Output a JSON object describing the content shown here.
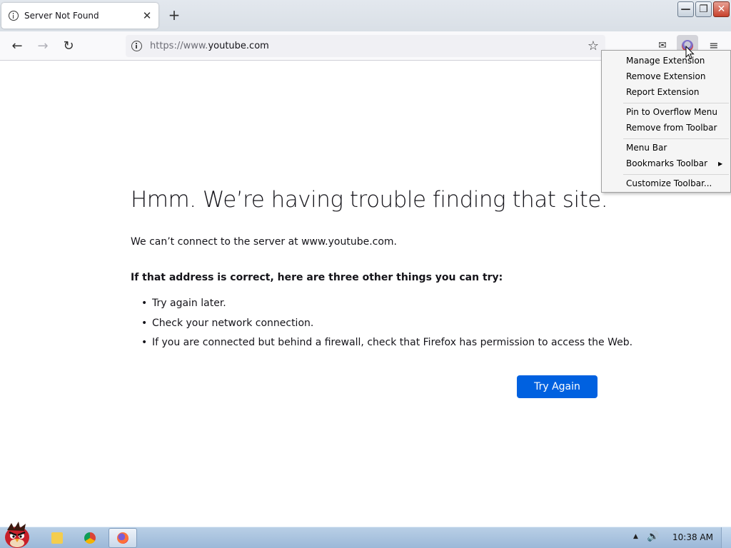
{
  "browser": {
    "tab": {
      "title": "Server Not Found",
      "close_glyph": "✕"
    },
    "new_tab_glyph": "+",
    "window_controls": {
      "minimize": "—",
      "restore": "❐",
      "close": "✕"
    },
    "nav": {
      "back_glyph": "←",
      "forward_glyph": "→",
      "reload_glyph": "↻"
    },
    "url": {
      "prefix": "https://www.",
      "domain": "youtube.com"
    },
    "bookmark_glyph": "☆",
    "pocket_glyph": "✉",
    "menu_glyph": "≡"
  },
  "error_page": {
    "title": "Hmm. We’re having trouble finding that site.",
    "description": "We can’t connect to the server at www.youtube.com.",
    "suggestions_heading": "If that address is correct, here are three other things you can try:",
    "suggestions": [
      "Try again later.",
      "Check your network connection.",
      "If you are connected but behind a firewall, check that Firefox has permission to access the Web."
    ],
    "try_again_label": "Try Again"
  },
  "context_menu": {
    "items": [
      "Manage Extension",
      "Remove Extension",
      "Report Extension",
      "Pin to Overflow Menu",
      "Remove from Toolbar",
      "Menu Bar",
      "Bookmarks Toolbar",
      "Customize Toolbar..."
    ],
    "submenu_arrow": "▶"
  },
  "taskbar": {
    "clock": "10:38 AM",
    "tray_arrow": "▲",
    "volume_glyph": "🔊"
  },
  "colors": {
    "accent_button": "#0061e0",
    "taskbar": "#b9cfe6"
  }
}
